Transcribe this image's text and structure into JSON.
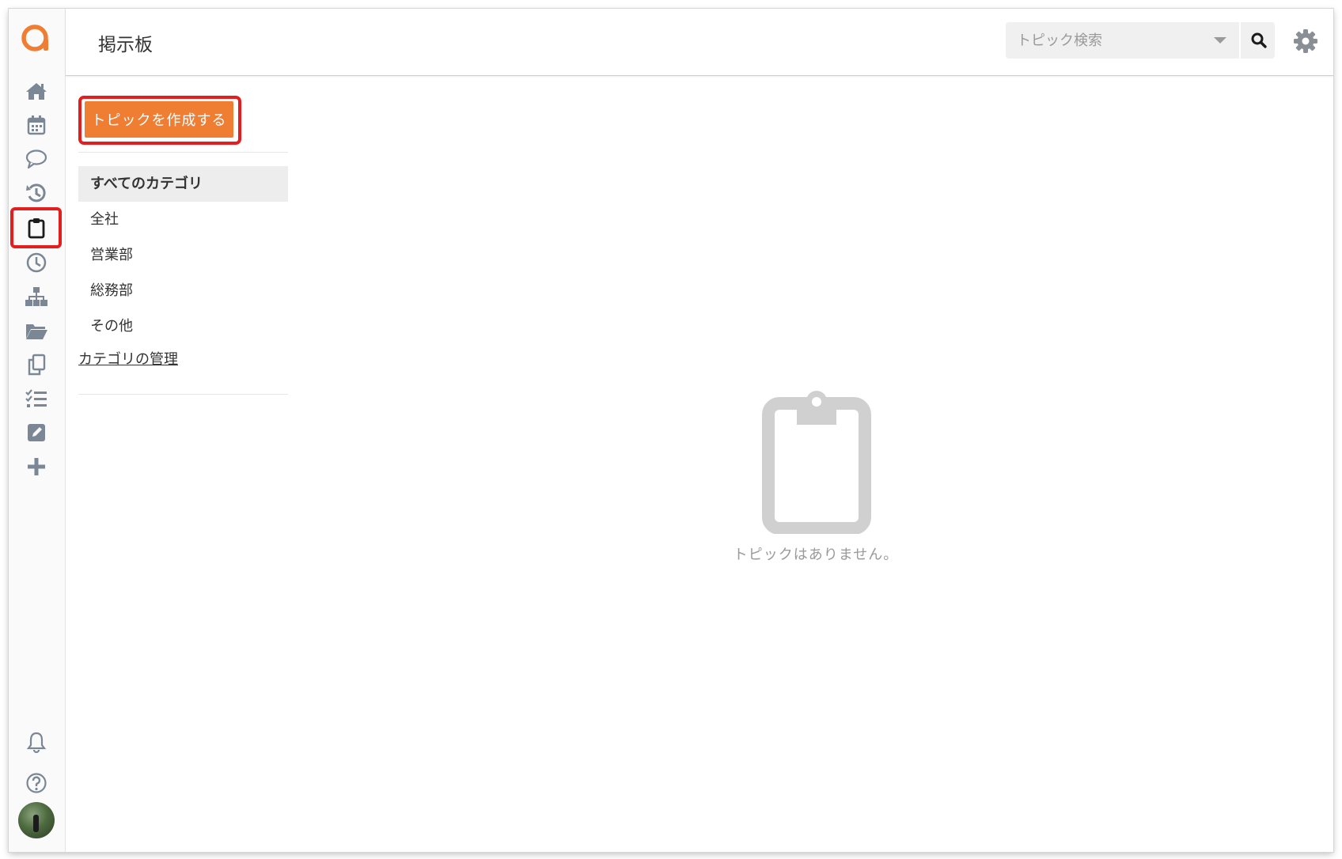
{
  "header": {
    "title": "掲示板",
    "search_placeholder": "トピック検索"
  },
  "sidebar": {
    "items": [
      {
        "name": "home-icon"
      },
      {
        "name": "calendar-icon"
      },
      {
        "name": "chat-bubble-icon"
      },
      {
        "name": "history-icon"
      },
      {
        "name": "clipboard-icon",
        "active": true
      },
      {
        "name": "clock-icon"
      },
      {
        "name": "org-chart-icon"
      },
      {
        "name": "folder-open-icon"
      },
      {
        "name": "copy-icon"
      },
      {
        "name": "task-list-icon"
      },
      {
        "name": "edit-icon"
      },
      {
        "name": "plus-icon"
      }
    ],
    "bottom": [
      {
        "name": "bell-icon"
      },
      {
        "name": "help-icon"
      },
      {
        "name": "avatar"
      }
    ]
  },
  "board": {
    "create_button_label": "トピックを作成する",
    "categories": [
      "すべてのカテゴリ",
      "全社",
      "営業部",
      "総務部",
      "その他"
    ],
    "selected_category": "すべてのカテゴリ",
    "manage_link": "カテゴリの管理",
    "empty_message": "トピックはありません。"
  },
  "colors": {
    "accent": "#ef7d32",
    "highlight": "#e31e1e",
    "icon": "#7b8794",
    "empty_icon": "#d0d0d0"
  }
}
